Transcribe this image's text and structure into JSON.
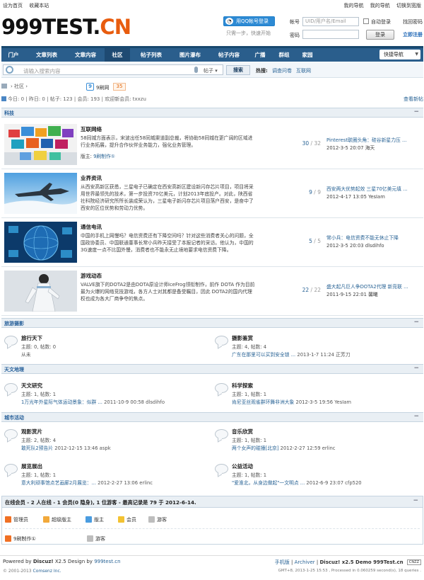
{
  "topbar": {
    "left": [
      "设为首页",
      "收藏本站"
    ],
    "right": [
      "我的导航",
      "我的导航",
      "切换到宽版"
    ]
  },
  "logo": {
    "main": "999TEST.",
    "accent": "CN"
  },
  "qq_login": {
    "label": "用QQ帐号登录",
    "tip": "只需一步，快速开始"
  },
  "login": {
    "account_label": "帐号",
    "account_placeholder": "UID/用户名/Email",
    "auto_login": "自动登录",
    "find_password": "找回密码",
    "password_label": "密码",
    "submit": "登录",
    "register": "立即注册"
  },
  "nav": {
    "items": [
      "门户",
      "文章列表",
      "文章内容",
      "社区",
      "帖子列表",
      "图片瀑布",
      "帖子内容",
      "广播",
      "群组",
      "家园"
    ],
    "active_index": 3,
    "quick": "快捷导航"
  },
  "search": {
    "placeholder": "请输入搜索内容",
    "type": "帖子",
    "button": "搜索",
    "hot_label": "热搜:",
    "hot_words": [
      "调查问卷",
      "互联网"
    ]
  },
  "crumb": {
    "label": "社区"
  },
  "tag": {
    "icon": "9",
    "label": "9刷网",
    "count": "35"
  },
  "stats": {
    "text": "今日: 0  |  昨日: 0  |  帖子: 123  |  会员: 193  |  欢迎新会员: txxzu",
    "new_posts": "查看新帖"
  },
  "sections": {
    "tech": "科技",
    "travel": "旅游摄影",
    "astronomy": "天文地理",
    "city": "城市活动"
  },
  "tech_forums": [
    {
      "name": "互联网络",
      "desc": "58同城方面表示，宋波出任58同城渠道副总裁，将协助58同城在更广阔的区域进行业务拓展，提升合作伙伴业务能力，强化业务管理。",
      "moderator_label": "版主:",
      "moderator": "9刷制作①",
      "count": "30",
      "total": "32",
      "last_title": "Pinterest联圈头角：硅谷新星力压 ...",
      "last_meta": "2012-3-5 20:07 海天"
    },
    {
      "name": "业界资讯",
      "desc": "从西安高新区获悉，三星电子已确定在西安高新区建设新闪存芯片项目，项目将采用世界最领先的技术，第一步投资70亿美元，计划2013年底投产。对此，陕西省社科院经济研究所所长装成荣认为，三星电子新闪存芯片项目落户西安，是奋中了西安的区位优势和劳动力优势。",
      "moderator_label": "",
      "moderator": "",
      "count": "9",
      "total": "9",
      "last_title": "西安两大优势起效 三星70亿美元填 ...",
      "last_meta": "2012-4-17 13:05 YesIam"
    },
    {
      "name": "通信电讯",
      "desc": "中国的手机上网慢吗？电信资费还有下降空间吗？针对这些消费者关心的问题，全国政协委员、中国联通董事长常小兵昨天接受了本报记者的采访。他认为，中国的3G速度一点不比国外慢，消费者也不能永无止境地要求电信资费下降。",
      "moderator_label": "",
      "moderator": "",
      "count": "5",
      "total": "5",
      "last_title": "常小兵：电信资费不能无休止下降",
      "last_meta": "2012-3-5 20:03 dlsdihfo"
    },
    {
      "name": "游戏动态",
      "desc": "VALVE旗下的DOTA2是由DOTA原设计师IceFrog领衔制作，前作 DOTA 作为目前最为火爆的网络竞技游戏，各方人士对其都是备受瞩目，因此 DOTA2的国内代理权也成为各大厂商争夺的焦点。",
      "moderator_label": "",
      "moderator": "",
      "count": "22",
      "total": "22",
      "last_title": "盛大起凡巨人争DOTA2代理 新竞联 ...",
      "last_meta": "2011-9-15 22:01 馨曦"
    }
  ],
  "travel_forums": [
    {
      "name": "旅行天下",
      "stats": "主题: 0, 帖数: 0",
      "last_link": "",
      "last_rest": "从未"
    },
    {
      "name": "摄影鉴赏",
      "stats": "主题: 4, 帖数: 4",
      "last_link": "广东在那里可以买到安全锁 ...",
      "last_rest": " 2013-1-7 11:24 正芳刀"
    }
  ],
  "astro_forums": [
    {
      "name": "天文研究",
      "stats": "主题: 1, 帖数: 1",
      "last_link": "1万光年外星际气体运动景象：似群 ...",
      "last_rest": " 2011-10-9 00:58 dlsdihfo"
    },
    {
      "name": "科学探索",
      "stats": "主题: 1, 帖数: 1",
      "last_link": "肯尼亚丝观雀群环舞非洲大象",
      "last_rest": " 2012-3-5 19:56 YesIam"
    }
  ],
  "city_forums": [
    {
      "name": "观影赏片",
      "stats": "主题: 2, 帖数: 4",
      "last_link": "敢死队2预告片",
      "last_rest": " 2012-12-15 13:46 aspk"
    },
    {
      "name": "音乐欣赏",
      "stats": "主题: 1, 帖数: 1",
      "last_link": "两个女声的碰撞[北京]",
      "last_rest": " 2012-2-27 12:59 erlinc"
    },
    {
      "name": "展览展出",
      "stats": "主题: 1, 帖数: 1",
      "last_link": "意大利顽事馆点艺画廊2月展览：...",
      "last_rest": " 2012-2-27 13:06 erlinc"
    },
    {
      "name": "公益活动",
      "stats": "主题: 1, 帖数: 1",
      "last_link": "\"爱淮北，从身边做起\"一文明点 ...",
      "last_rest": " 2012-6-9 23:07 cfp520"
    }
  ],
  "online": {
    "title": "在线会员 - 2 人在线 - 1 会员(0 隐身), 1 位游客 - 最高记录是 79 于 2012-6-14.",
    "legend": [
      "管理员",
      "超级版主",
      "版主",
      "会员",
      "游客"
    ],
    "users": [
      "9刷制作①",
      "游客"
    ],
    "colors": {
      "admin": "#f07024",
      "super": "#f2a93b",
      "mod": "#4a9ce0",
      "member": "#f3c232",
      "guest": "#bdbdbd"
    }
  },
  "footer": {
    "powered": "Powered by",
    "discuz": "Discuz!",
    "version_design": " X2.5 Design by ",
    "site": "999test.cn",
    "copyright": "© 2001-2013 ",
    "company": "Comsenz Inc.",
    "links": [
      "手机版",
      "Archiver"
    ],
    "demo": "Discuz! x2.5 Demo 999Test.cn",
    "badge": "CNZZ",
    "gmt": "GMT+8, 2013-1-25 15:53 , Processed in 0.060259 second(s), 18 queries ."
  }
}
